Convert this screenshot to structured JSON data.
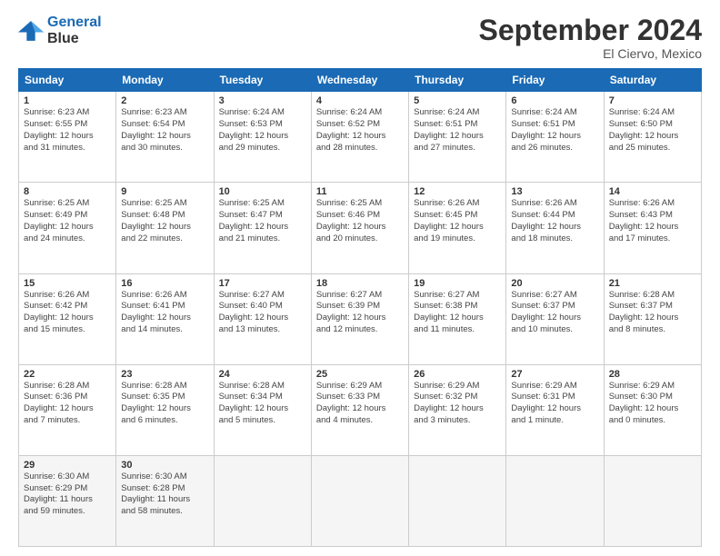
{
  "logo": {
    "line1": "General",
    "line2": "Blue"
  },
  "title": "September 2024",
  "subtitle": "El Ciervo, Mexico",
  "days_of_week": [
    "Sunday",
    "Monday",
    "Tuesday",
    "Wednesday",
    "Thursday",
    "Friday",
    "Saturday"
  ],
  "weeks": [
    [
      {
        "day": 1,
        "info": "Sunrise: 6:23 AM\nSunset: 6:55 PM\nDaylight: 12 hours\nand 31 minutes."
      },
      {
        "day": 2,
        "info": "Sunrise: 6:23 AM\nSunset: 6:54 PM\nDaylight: 12 hours\nand 30 minutes."
      },
      {
        "day": 3,
        "info": "Sunrise: 6:24 AM\nSunset: 6:53 PM\nDaylight: 12 hours\nand 29 minutes."
      },
      {
        "day": 4,
        "info": "Sunrise: 6:24 AM\nSunset: 6:52 PM\nDaylight: 12 hours\nand 28 minutes."
      },
      {
        "day": 5,
        "info": "Sunrise: 6:24 AM\nSunset: 6:51 PM\nDaylight: 12 hours\nand 27 minutes."
      },
      {
        "day": 6,
        "info": "Sunrise: 6:24 AM\nSunset: 6:51 PM\nDaylight: 12 hours\nand 26 minutes."
      },
      {
        "day": 7,
        "info": "Sunrise: 6:24 AM\nSunset: 6:50 PM\nDaylight: 12 hours\nand 25 minutes."
      }
    ],
    [
      {
        "day": 8,
        "info": "Sunrise: 6:25 AM\nSunset: 6:49 PM\nDaylight: 12 hours\nand 24 minutes."
      },
      {
        "day": 9,
        "info": "Sunrise: 6:25 AM\nSunset: 6:48 PM\nDaylight: 12 hours\nand 22 minutes."
      },
      {
        "day": 10,
        "info": "Sunrise: 6:25 AM\nSunset: 6:47 PM\nDaylight: 12 hours\nand 21 minutes."
      },
      {
        "day": 11,
        "info": "Sunrise: 6:25 AM\nSunset: 6:46 PM\nDaylight: 12 hours\nand 20 minutes."
      },
      {
        "day": 12,
        "info": "Sunrise: 6:26 AM\nSunset: 6:45 PM\nDaylight: 12 hours\nand 19 minutes."
      },
      {
        "day": 13,
        "info": "Sunrise: 6:26 AM\nSunset: 6:44 PM\nDaylight: 12 hours\nand 18 minutes."
      },
      {
        "day": 14,
        "info": "Sunrise: 6:26 AM\nSunset: 6:43 PM\nDaylight: 12 hours\nand 17 minutes."
      }
    ],
    [
      {
        "day": 15,
        "info": "Sunrise: 6:26 AM\nSunset: 6:42 PM\nDaylight: 12 hours\nand 15 minutes."
      },
      {
        "day": 16,
        "info": "Sunrise: 6:26 AM\nSunset: 6:41 PM\nDaylight: 12 hours\nand 14 minutes."
      },
      {
        "day": 17,
        "info": "Sunrise: 6:27 AM\nSunset: 6:40 PM\nDaylight: 12 hours\nand 13 minutes."
      },
      {
        "day": 18,
        "info": "Sunrise: 6:27 AM\nSunset: 6:39 PM\nDaylight: 12 hours\nand 12 minutes."
      },
      {
        "day": 19,
        "info": "Sunrise: 6:27 AM\nSunset: 6:38 PM\nDaylight: 12 hours\nand 11 minutes."
      },
      {
        "day": 20,
        "info": "Sunrise: 6:27 AM\nSunset: 6:37 PM\nDaylight: 12 hours\nand 10 minutes."
      },
      {
        "day": 21,
        "info": "Sunrise: 6:28 AM\nSunset: 6:37 PM\nDaylight: 12 hours\nand 8 minutes."
      }
    ],
    [
      {
        "day": 22,
        "info": "Sunrise: 6:28 AM\nSunset: 6:36 PM\nDaylight: 12 hours\nand 7 minutes."
      },
      {
        "day": 23,
        "info": "Sunrise: 6:28 AM\nSunset: 6:35 PM\nDaylight: 12 hours\nand 6 minutes."
      },
      {
        "day": 24,
        "info": "Sunrise: 6:28 AM\nSunset: 6:34 PM\nDaylight: 12 hours\nand 5 minutes."
      },
      {
        "day": 25,
        "info": "Sunrise: 6:29 AM\nSunset: 6:33 PM\nDaylight: 12 hours\nand 4 minutes."
      },
      {
        "day": 26,
        "info": "Sunrise: 6:29 AM\nSunset: 6:32 PM\nDaylight: 12 hours\nand 3 minutes."
      },
      {
        "day": 27,
        "info": "Sunrise: 6:29 AM\nSunset: 6:31 PM\nDaylight: 12 hours\nand 1 minute."
      },
      {
        "day": 28,
        "info": "Sunrise: 6:29 AM\nSunset: 6:30 PM\nDaylight: 12 hours\nand 0 minutes."
      }
    ],
    [
      {
        "day": 29,
        "info": "Sunrise: 6:30 AM\nSunset: 6:29 PM\nDaylight: 11 hours\nand 59 minutes."
      },
      {
        "day": 30,
        "info": "Sunrise: 6:30 AM\nSunset: 6:28 PM\nDaylight: 11 hours\nand 58 minutes."
      },
      null,
      null,
      null,
      null,
      null
    ]
  ]
}
